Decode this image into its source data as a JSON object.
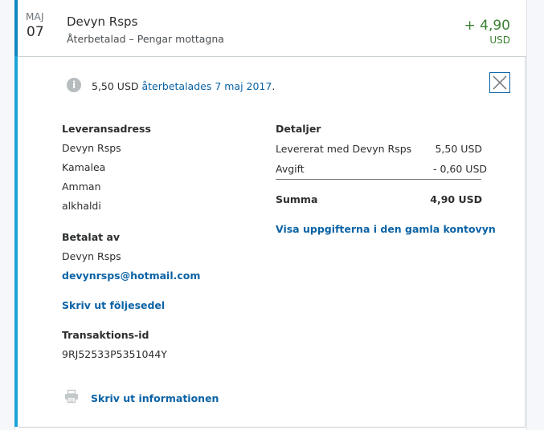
{
  "transaction": {
    "month": "MAJ",
    "day": "07",
    "name": "Devyn Rsps",
    "status": "Återbetalad – Pengar mottagna",
    "amount": "+ 4,90",
    "currency": "USD"
  },
  "detail": {
    "info_icon": "info-icon",
    "info_prefix": "5,50 USD ",
    "info_link": "återbetalades 7 maj 2017",
    "info_suffix": ".",
    "close_icon": "close-icon",
    "shipping": {
      "heading": "Leveransadress",
      "lines": [
        "Devyn Rsps",
        "Kamalea",
        "Amman",
        "alkhaldi"
      ]
    },
    "paid_by": {
      "heading": "Betalat av",
      "name": "Devyn Rsps",
      "email": "devynrsps@hotmail.com"
    },
    "packing_slip_link": "Skriv ut följesedel",
    "transaction_id": {
      "heading": "Transaktions-id",
      "value": "9RJ52533P5351044Y"
    },
    "print_icon": "printer-icon",
    "print_link": "Skriv ut informationen",
    "details": {
      "heading": "Detaljer",
      "rows": [
        {
          "label": "Levererat med Devyn Rsps",
          "value": "5,50 USD"
        },
        {
          "label": "Avgift",
          "value": "- 0,60 USD"
        }
      ],
      "total_label": "Summa",
      "total_value": "4,90 USD"
    },
    "old_view_link": "Visa uppgifterna i den gamla kontovyn"
  },
  "colors": {
    "accent": "#0f86c4",
    "link": "#0b63a5",
    "positive": "#3b8132"
  }
}
